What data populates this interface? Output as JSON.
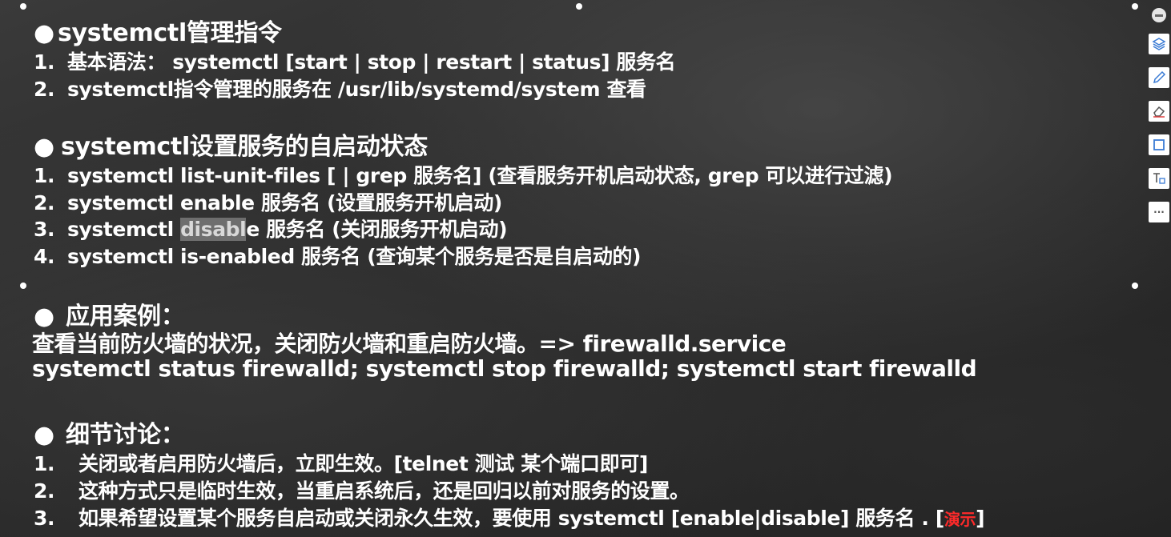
{
  "sections": {
    "s1": {
      "title": "systemctl管理指令",
      "items": [
        {
          "num": "1.",
          "text": "基本语法： systemctl  [start | stop | restart | status] 服务名"
        },
        {
          "num": "2.",
          "text": "systemctl指令管理的服务在 /usr/lib/systemd/system 查看"
        }
      ]
    },
    "s2": {
      "title": "systemctl设置服务的自启动状态",
      "items": [
        {
          "num": "1.",
          "text": "systemctl list-unit-files  [ | grep 服务名] (查看服务开机启动状态, grep 可以进行过滤)"
        },
        {
          "num": "2.",
          "text": "systemctl enable 服务名 (设置服务开机启动)"
        },
        {
          "num": "3.",
          "text_pre": "systemctl ",
          "text_hl": "disabl",
          "text_post": "e 服务名 (关闭服务开机启动)"
        },
        {
          "num": "4.",
          "text": "systemctl is-enabled 服务名 (查询某个服务是否是自启动的)"
        }
      ]
    },
    "s3": {
      "title": "应用案例：",
      "lines": [
        "查看当前防火墙的状况，关闭防火墙和重启防火墙。=> firewalld.service",
        "systemctl status firewalld; systemctl stop firewalld; systemctl start firewalld"
      ]
    },
    "s4": {
      "title": "细节讨论：",
      "items": [
        {
          "num": "1.",
          "text": "关闭或者启用防火墙后，立即生效。[telnet 测试  某个端口即可]"
        },
        {
          "num": "2.",
          "text": "这种方式只是临时生效，当重启系统后，还是回归以前对服务的设置。"
        },
        {
          "num": "3.",
          "text": "如果希望设置某个服务自启动或关闭永久生效，要使用 systemctl  [enable|disable] 服务名 . [",
          "tag": "演示",
          "close": "]"
        }
      ]
    }
  },
  "bullet": "●",
  "toolbar": {
    "tools": [
      "layers-icon",
      "pen-icon",
      "eraser-icon",
      "shape-icon",
      "text-icon",
      "more-icon"
    ],
    "more_label": "···"
  },
  "colors": {
    "text": "#ffffff",
    "demo_tag": "#ff2a2a",
    "highlight": "#a0a0a0"
  }
}
